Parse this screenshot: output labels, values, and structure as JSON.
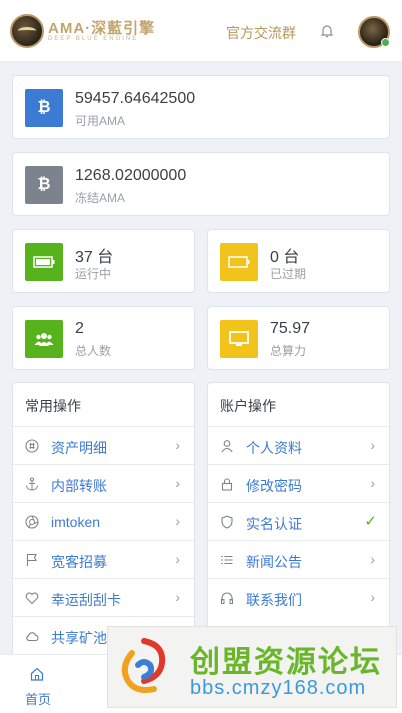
{
  "header": {
    "logo_text": "AMA·深藍引擎",
    "logo_sub": "DEEP BLUE ENGINE",
    "group_link": "官方交流群"
  },
  "balances": [
    {
      "value": "59457.64642500",
      "label": "可用AMA",
      "icon": "bitcoin-icon",
      "color": "#3c7bd4"
    },
    {
      "value": "1268.02000000",
      "label": "冻结AMA",
      "icon": "bitcoin-icon",
      "color": "#7d838c"
    }
  ],
  "stats": [
    {
      "value": "37 台",
      "label": "运行中",
      "icon": "battery-full-icon",
      "color": "#57b31c"
    },
    {
      "value": "0 台",
      "label": "已过期",
      "icon": "battery-empty-icon",
      "color": "#f2c31a"
    },
    {
      "value": "2",
      "label": "总人数",
      "icon": "users-icon",
      "color": "#57b31c"
    },
    {
      "value": "75.97",
      "label": "总算力",
      "icon": "monitor-icon",
      "color": "#f2c31a"
    }
  ],
  "common_ops": {
    "title": "常用操作",
    "items": [
      {
        "label": "资产明细",
        "icon": "asset-icon"
      },
      {
        "label": "内部转账",
        "icon": "anchor-icon"
      },
      {
        "label": "imtoken",
        "icon": "aperture-icon"
      },
      {
        "label": "宽客招募",
        "icon": "flag-icon"
      },
      {
        "label": "幸运刮刮卡",
        "icon": "heart-icon"
      },
      {
        "label": "共享矿池",
        "icon": "cloud-icon"
      }
    ]
  },
  "account_ops": {
    "title": "账户操作",
    "items": [
      {
        "label": "个人资料",
        "icon": "user-icon"
      },
      {
        "label": "修改密码",
        "icon": "lock-icon"
      },
      {
        "label": "实名认证",
        "icon": "shield-icon",
        "verified": true
      },
      {
        "label": "新闻公告",
        "icon": "list-icon"
      },
      {
        "label": "联系我们",
        "icon": "headphones-icon"
      }
    ]
  },
  "bottom_nav": {
    "home_label": "首页"
  },
  "watermark": {
    "title": "创盟资源论坛",
    "url": "bbs.cmzy168.com"
  }
}
